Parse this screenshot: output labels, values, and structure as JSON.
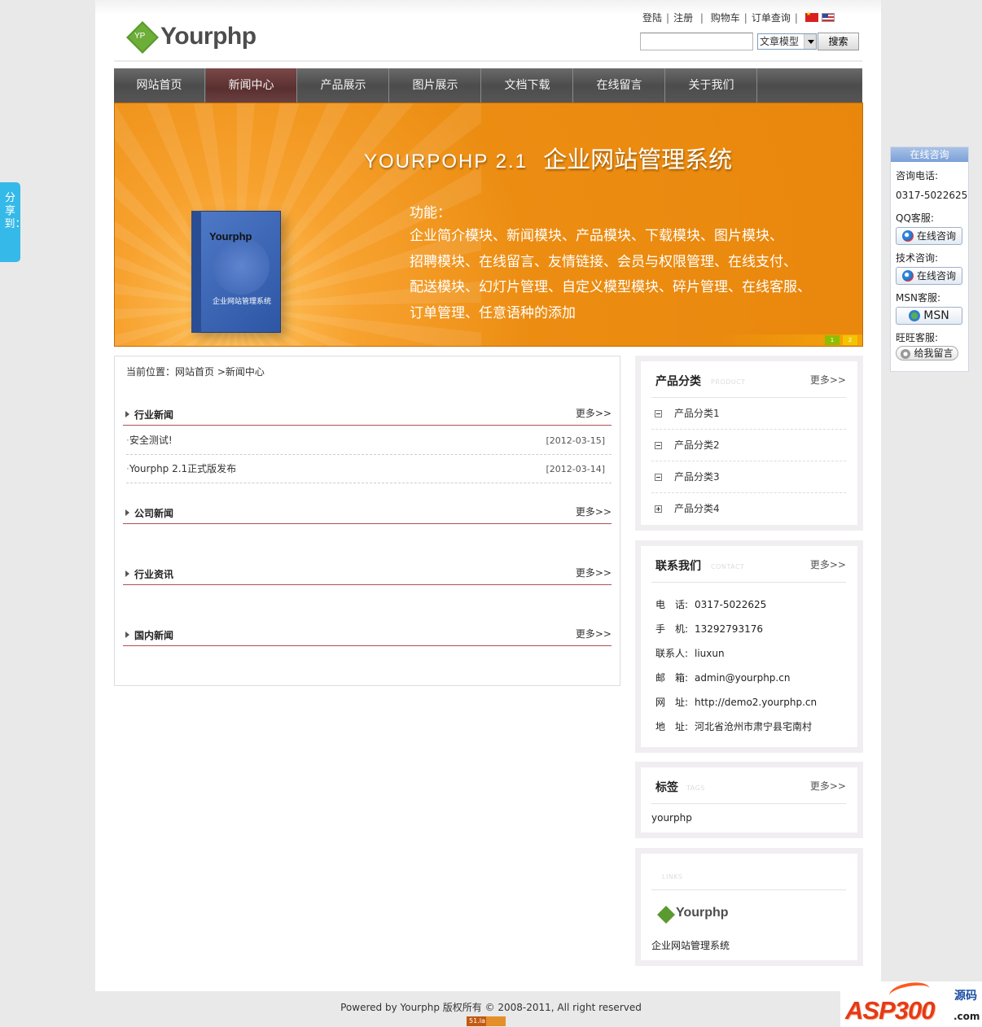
{
  "header": {
    "logo_mark": "YP",
    "logo_text": "Yourphp",
    "links": [
      "登陆",
      "注册",
      "购物车",
      "订单查询"
    ],
    "search": {
      "placeholder": "",
      "select_value": "文章模型",
      "button": "搜索"
    }
  },
  "nav": [
    {
      "label": "网站首页",
      "active": false
    },
    {
      "label": "新闻中心",
      "active": true
    },
    {
      "label": "产品展示",
      "active": false
    },
    {
      "label": "图片展示",
      "active": false
    },
    {
      "label": "文档下载",
      "active": false
    },
    {
      "label": "在线留言",
      "active": false
    },
    {
      "label": "关于我们",
      "active": false
    }
  ],
  "banner": {
    "title_en": "YOURPOHP 2.1",
    "title_cn": "企业网站管理系统",
    "feature_label": "功能：",
    "features": [
      "企业简介模块、新闻模块、产品模块、下载模块、图片模块、",
      "招聘模块、在线留言、友情链接、会员与权限管理、在线支付、",
      "配送模块、幻灯片管理、自定义模型模块、碎片管理、在线客服、",
      "订单管理、任意语种的添加"
    ],
    "box_logo": "Yourphp",
    "box_caption": "企业网站管理系统",
    "dots": [
      "1",
      "2"
    ]
  },
  "main": {
    "breadcrumb": "当前位置：网站首页 >新闻中心",
    "more_label": "更多>>",
    "sections": [
      {
        "title": "行业新闻",
        "items": [
          {
            "title": "安全测试!",
            "date": "[2012-03-15]"
          },
          {
            "title": "Yourphp 2.1正式版发布",
            "date": "[2012-03-14]"
          }
        ]
      },
      {
        "title": "公司新闻",
        "items": []
      },
      {
        "title": "行业资讯",
        "items": []
      },
      {
        "title": "国内新闻",
        "items": []
      }
    ]
  },
  "sidebar": {
    "more_label": "更多>>",
    "categories": {
      "title": "产品分类",
      "sub": "PRODUCT",
      "items": [
        {
          "label": "产品分类1",
          "expanded": true
        },
        {
          "label": "产品分类2",
          "expanded": true
        },
        {
          "label": "产品分类3",
          "expanded": true
        },
        {
          "label": "产品分类4",
          "expanded": false
        }
      ]
    },
    "contact": {
      "title": "联系我们",
      "sub": "CONTACT",
      "rows": [
        {
          "key": "电　话:",
          "value": "0317-5022625"
        },
        {
          "key": "手　机:",
          "value": "13292793176"
        },
        {
          "key": "联系人:",
          "value": "liuxun"
        },
        {
          "key": "邮　箱:",
          "value": "admin@yourphp.cn"
        },
        {
          "key": "网　址:",
          "value": "http://demo2.yourphp.cn"
        },
        {
          "key": "地　址:",
          "value": "河北省沧州市肃宁县宅南村"
        }
      ]
    },
    "tags": {
      "title": "标签",
      "sub": "TAGS",
      "items": [
        "yourphp"
      ]
    },
    "links": {
      "sub": "LINKS",
      "logo_text": "Yourphp",
      "caption": "企业网站管理系统"
    }
  },
  "online": {
    "header": "在线咨询",
    "phone_label": "咨询电话:",
    "phone": "0317-5022625",
    "qq_label": "QQ客服:",
    "qq_button": "在线咨询",
    "tech_label": "技术咨询:",
    "tech_button": "在线咨询",
    "msn_label": "MSN客服:",
    "msn_button": "MSN",
    "wangwang_label": "旺旺客服:",
    "wangwang_button": "给我留言"
  },
  "share_tab": "分享到：",
  "footer": {
    "text": "Powered by Yourphp 版权所有 © 2008-2011, All right reserved",
    "counter": "51.la"
  },
  "watermark": {
    "text": "ASP300",
    "cn": "源码",
    "com": ".com"
  },
  "colors": {
    "nav_bg": "#555555",
    "nav_active": "#6a3a3a",
    "banner": "#e9870c",
    "section_rule": "#b05050"
  }
}
